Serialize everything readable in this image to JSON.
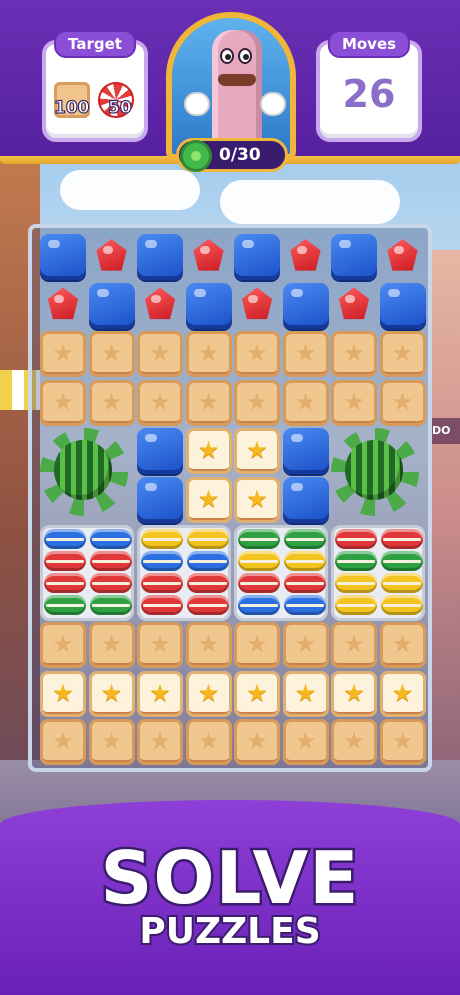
{
  "hud": {
    "target_label": "Target",
    "moves_label": "Moves",
    "moves_value": "26",
    "targets": [
      {
        "icon": "crate-icon",
        "count": "100"
      },
      {
        "icon": "peppermint-candy-icon",
        "count": "50"
      }
    ],
    "progress": "0/30"
  },
  "board": {
    "rows": [
      [
        "blue",
        "red",
        "blue",
        "red",
        "blue",
        "red",
        "blue",
        "red"
      ],
      [
        "red",
        "blue",
        "red",
        "blue",
        "red",
        "blue",
        "red",
        "blue"
      ],
      [
        "crate",
        "crate",
        "crate",
        "crate",
        "crate",
        "crate",
        "crate",
        "crate"
      ],
      [
        "crate",
        "crate",
        "crate",
        "crate",
        "crate",
        "crate",
        "crate",
        "crate"
      ],
      [
        "watermelon",
        "",
        "blue",
        "star-crate",
        "star-crate",
        "blue",
        "watermelon",
        ""
      ],
      [
        "",
        "",
        "blue",
        "star-crate",
        "star-crate",
        "blue",
        "",
        ""
      ],
      [
        "macaron-stack",
        "",
        "macaron-stack",
        "",
        "macaron-stack",
        "",
        "macaron-stack",
        ""
      ],
      [
        "",
        "",
        "",
        "",
        "",
        "",
        "",
        ""
      ],
      [
        "crate",
        "crate",
        "crate",
        "crate",
        "crate",
        "crate",
        "crate",
        "crate"
      ],
      [
        "star-crate",
        "star-crate",
        "star-crate",
        "star-crate",
        "star-crate",
        "star-crate",
        "star-crate",
        "star-crate"
      ],
      [
        "crate",
        "crate",
        "crate",
        "crate",
        "crate",
        "crate",
        "crate",
        "crate"
      ]
    ]
  },
  "banner": {
    "title": "SOLVE",
    "subtitle": "PUZZLES"
  }
}
